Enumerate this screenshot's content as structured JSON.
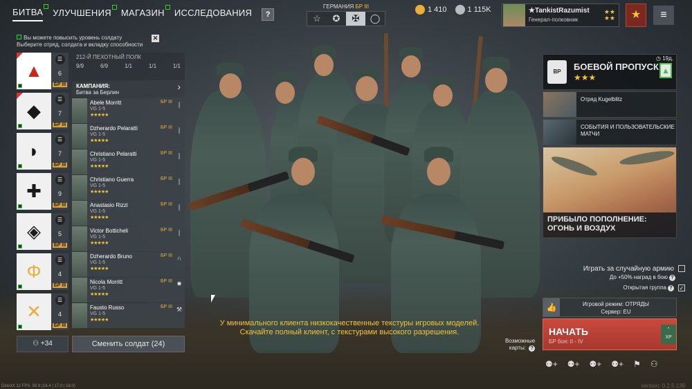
{
  "nav": {
    "tabs": [
      "БИТВА",
      "УЛУЧШЕНИЯ",
      "МАГАЗИН",
      "ИССЛЕДОВАНИЯ"
    ],
    "help": "?"
  },
  "nation": {
    "label": "ГЕРМАНИЯ",
    "br": "БР III",
    "tabs": [
      "☆",
      "✪",
      "✠",
      "◯"
    ]
  },
  "currency": {
    "gold": "1 410",
    "silver": "1 115K",
    "gold_color": "#e8b03a",
    "silver_color": "#b8bcc0"
  },
  "profile": {
    "name": "TankistRazumist",
    "rank": "Генерал-полковник"
  },
  "notice": {
    "line1": "Вы можете повысить уровень солдату",
    "line2": "Выберите отряд, солдата и вкладку способности",
    "close": "✕"
  },
  "squads": [
    {
      "icon": "▲",
      "count": "6",
      "br": "БР III"
    },
    {
      "icon": "◆",
      "count": "7",
      "br": "БР III"
    },
    {
      "icon": "◗",
      "count": "7",
      "br": "БР III"
    },
    {
      "icon": "✚",
      "count": "9",
      "br": "БР III"
    },
    {
      "icon": "◈",
      "count": "5",
      "br": "БР III"
    },
    {
      "icon": "Φ",
      "count": "4",
      "br": "БР III"
    },
    {
      "icon": "✕",
      "count": "4",
      "br": "БР III"
    }
  ],
  "reserve": {
    "count": "+34"
  },
  "regiment": {
    "title": "212-Й ПЕХОТНЫЙ ПОЛК",
    "stats": [
      "9/9",
      "6/9",
      "1/1",
      "1/1",
      "1/1"
    ]
  },
  "campaign": {
    "label": "КАМПАНИЯ:",
    "value": "Битва за Берлин"
  },
  "soldiers": [
    {
      "name": "Abele Morritt",
      "weapon": "VG 1-5",
      "stars": "★★★★★",
      "br": "БР III",
      "icon": "❘"
    },
    {
      "name": "Dzherardo Pelaratti",
      "weapon": "VG 1-5",
      "stars": "★★★★★",
      "br": "БР III",
      "icon": "❘"
    },
    {
      "name": "Christiano Pelaratti",
      "weapon": "VG 1-5",
      "stars": "★★★★★",
      "br": "БР III",
      "icon": "❘"
    },
    {
      "name": "Christiano Guerra",
      "weapon": "VG 1-5",
      "stars": "★★★★★",
      "br": "БР III",
      "icon": "❘"
    },
    {
      "name": "Anastasio Rizzi",
      "weapon": "VG 1-5",
      "stars": "★★★★★",
      "br": "БР III",
      "icon": "❘"
    },
    {
      "name": "Victor Botticheli",
      "weapon": "VG 1-5",
      "stars": "★★★★★",
      "br": "БР III",
      "icon": "❘"
    },
    {
      "name": "Dzherardo Bruno",
      "weapon": "VG 1-5",
      "stars": "★★★★★",
      "br": "БР III",
      "icon": "∩"
    },
    {
      "name": "Nicola Morritt",
      "weapon": "VG 1-5",
      "stars": "★★★★★",
      "br": "БР III",
      "icon": "✹"
    },
    {
      "name": "Fausto Russo",
      "weapon": "VG 1-5",
      "stars": "★★★★★",
      "br": "БР III",
      "icon": "⚒"
    }
  ],
  "change_button": "Сменить солдат (24)",
  "battle_pass": {
    "title": "БОЕВОЙ ПРОПУСК",
    "stars": "★★★",
    "days": "19д."
  },
  "events": [
    {
      "text": "Отряд Kugelblitz"
    },
    {
      "text": "СОБЫТИЯ И ПОЛЬЗОВАТЕЛЬСКИЕ МАТЧИ"
    }
  ],
  "promo": {
    "title": "ПРИБЫЛО ПОПОЛНЕНИЕ: ОГОНЬ И ВОЗДУХ"
  },
  "options": {
    "random_army": "Играть за случайную армию",
    "random_bonus": "До +50% наград в бою",
    "open_group": "Открытая группа"
  },
  "mode": {
    "line1": "Игровой режим: ОТРЯДЫ",
    "line2": "Сервер: EU"
  },
  "start": {
    "label": "НАЧАТЬ",
    "sub": "БР боя: II - IV",
    "xp": "XP"
  },
  "maps": {
    "line1": "Возможные",
    "line2": "карты:"
  },
  "subtitle": "У минимального клиента низкокачественные текстуры игровых моделей. Скачайте полный клиент, с текстурами высокого разрешения.",
  "debug": "DirectX 12 FPS: 59.9 (16.4 | 17.0 | 18.0)",
  "version": "version: 0.2.5.139"
}
